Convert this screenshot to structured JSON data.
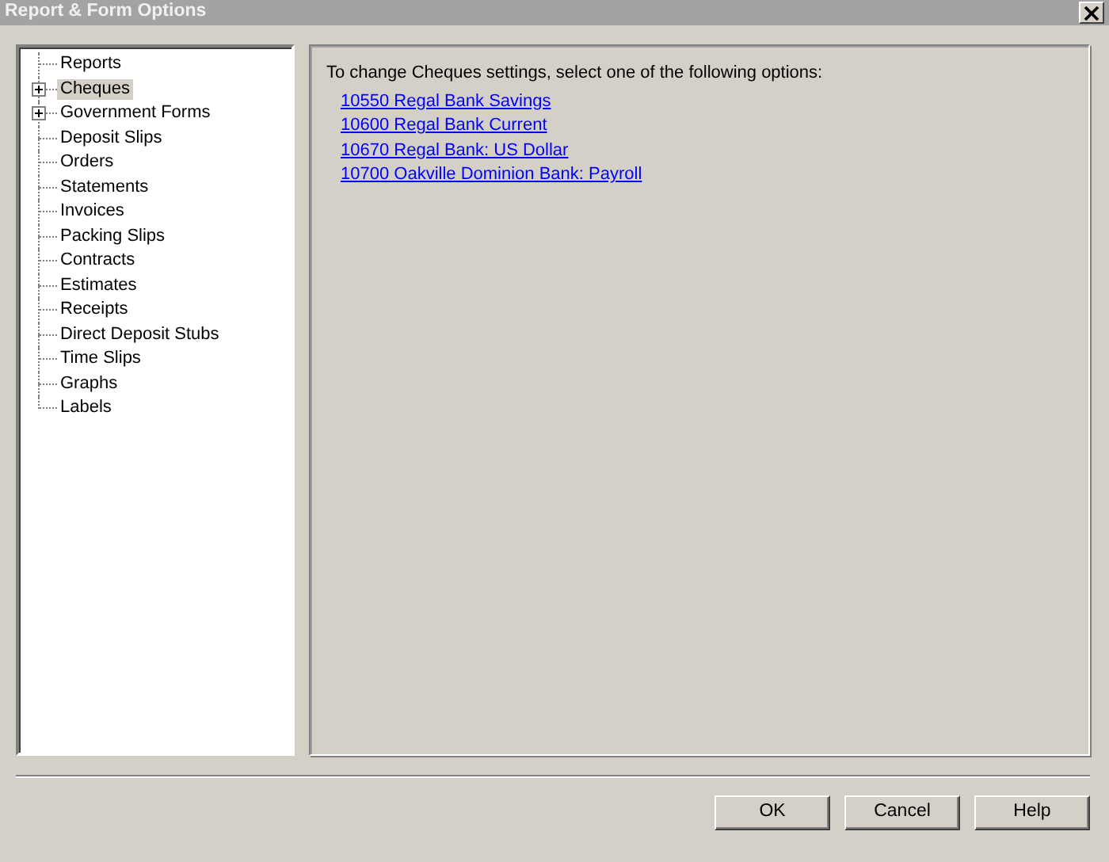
{
  "window": {
    "title": "Report & Form Options"
  },
  "tree": {
    "items": [
      {
        "label": "Reports",
        "selected": false
      },
      {
        "label": "Cheques",
        "selected": true,
        "expanded": false
      },
      {
        "label": "Government Forms",
        "selected": false,
        "expanded": false
      },
      {
        "label": "Deposit Slips",
        "selected": false
      },
      {
        "label": "Orders",
        "selected": false
      },
      {
        "label": "Statements",
        "selected": false
      },
      {
        "label": "Invoices",
        "selected": false
      },
      {
        "label": "Packing Slips",
        "selected": false
      },
      {
        "label": "Contracts",
        "selected": false
      },
      {
        "label": "Estimates",
        "selected": false
      },
      {
        "label": "Receipts",
        "selected": false
      },
      {
        "label": "Direct Deposit Stubs",
        "selected": false
      },
      {
        "label": "Time Slips",
        "selected": false
      },
      {
        "label": "Graphs",
        "selected": false
      },
      {
        "label": "Labels",
        "selected": false
      }
    ]
  },
  "content": {
    "instruction": "To change Cheques settings, select one of the following options:",
    "links": [
      "10550 Regal Bank Savings",
      "10600 Regal Bank Current",
      "10670 Regal Bank: US Dollar",
      "10700 Oakville Dominion Bank: Payroll"
    ]
  },
  "buttons": [
    "OK",
    "Cancel",
    "Help"
  ]
}
